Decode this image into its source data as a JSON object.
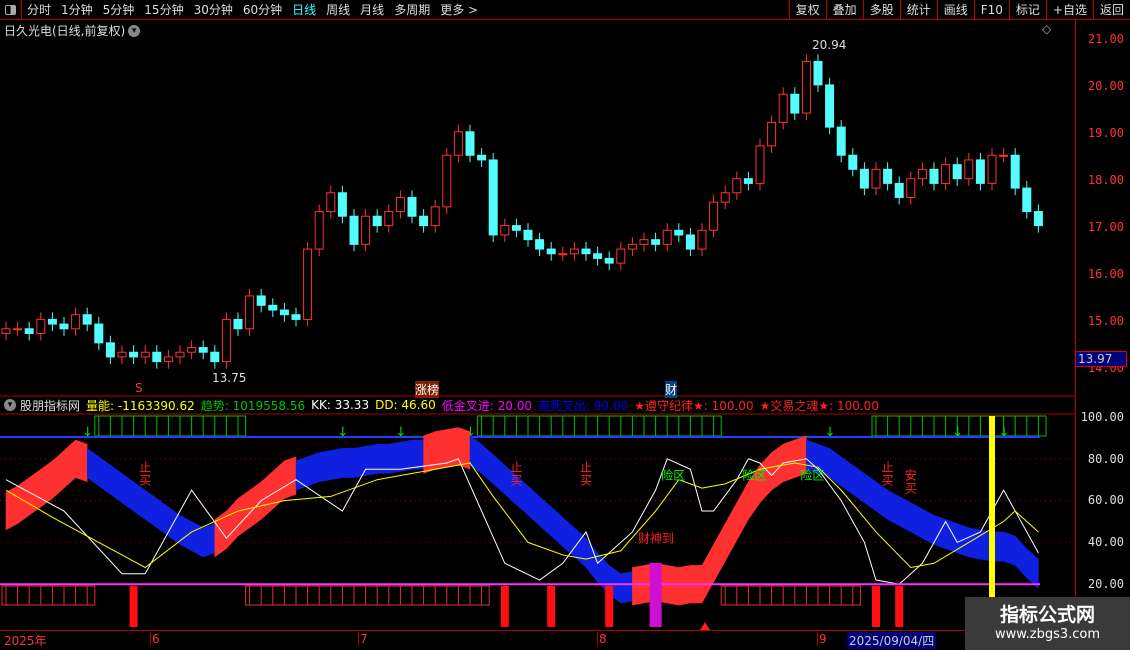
{
  "toolbar": {
    "periods": [
      "分时",
      "1分钟",
      "5分钟",
      "15分钟",
      "30分钟",
      "60分钟",
      "日线",
      "周线",
      "月线",
      "多周期",
      "更多 >"
    ],
    "active_period": "日线",
    "right_buttons": [
      "复权",
      "叠加",
      "多股",
      "统计",
      "画线",
      "F10",
      "标记",
      "+自选",
      "返回"
    ]
  },
  "title": "日久光电(日线,前复权)",
  "price_axis": [
    "21.00",
    "20.00",
    "19.00",
    "18.00",
    "17.00",
    "16.00",
    "15.00",
    "14.00"
  ],
  "last_price": "13.97",
  "high_label": "20.94",
  "low_label": "13.75",
  "markers": {
    "m1": "S",
    "m2": "涨榜",
    "m3": "财"
  },
  "indicator": {
    "name": "股朋指标网",
    "items": [
      {
        "label": "量能: -1163390.62",
        "color": "#ffff00"
      },
      {
        "label": "趋势: 1019558.56",
        "color": "#00c000"
      },
      {
        "label": "KK: 33.33",
        "color": "#ffffff"
      },
      {
        "label": "DD: 46.60",
        "color": "#ffff00"
      },
      {
        "label": "低金叉进: 20.00",
        "color": "#ff00ff"
      },
      {
        "label": "高死叉出: 90.00",
        "color": "#0000ff"
      },
      {
        "label": "★遵守纪律★: 100.00",
        "color": "#ff2020"
      },
      {
        "label": "★交易之魂★: 100.00",
        "color": "#ff2020"
      }
    ],
    "axis": [
      "100.00",
      "80.00",
      "60.00",
      "40.00",
      "20.00"
    ],
    "signals": {
      "stop": "止买",
      "safe": "安买",
      "risk": "险区",
      "wealth": "财神到"
    }
  },
  "dates": {
    "d0": "2025年",
    "d6": "6",
    "d7": "7",
    "d8": "8",
    "d9": "9",
    "current": "2025/09/04/四"
  },
  "watermark": {
    "line1": "指标公式网",
    "line2": "www.zbgs3.com"
  },
  "chart_data": {
    "type": "candlestick",
    "closes": [
      14.8,
      14.8,
      14.7,
      15.0,
      14.9,
      14.8,
      15.1,
      14.9,
      14.5,
      14.2,
      14.3,
      14.2,
      14.3,
      14.1,
      14.2,
      14.3,
      14.4,
      14.3,
      14.1,
      15.0,
      14.8,
      15.5,
      15.3,
      15.2,
      15.1,
      15.0,
      16.5,
      17.3,
      17.7,
      17.2,
      16.6,
      17.2,
      17.0,
      17.3,
      17.6,
      17.2,
      17.0,
      17.4,
      18.5,
      19.0,
      18.5,
      18.4,
      16.8,
      17.0,
      16.9,
      16.7,
      16.5,
      16.4,
      16.4,
      16.5,
      16.4,
      16.3,
      16.2,
      16.5,
      16.6,
      16.7,
      16.6,
      16.9,
      16.8,
      16.5,
      16.9,
      17.5,
      17.7,
      18.0,
      17.9,
      18.7,
      19.2,
      19.8,
      19.4,
      20.5,
      20.0,
      19.1,
      18.5,
      18.2,
      17.8,
      18.2,
      17.9,
      17.6,
      18.0,
      18.2,
      17.9,
      18.3,
      18.0,
      18.4,
      17.9,
      18.5,
      18.5,
      17.8,
      17.3,
      17.0
    ],
    "ylim": [
      13.6,
      21.3
    ],
    "indicator": {
      "ylim": [
        0,
        105
      ],
      "band_center": [
        55,
        58,
        62,
        66,
        70,
        75,
        80,
        78,
        74,
        70,
        66,
        62,
        58,
        54,
        50,
        46,
        43,
        40,
        42,
        46,
        52,
        56,
        60,
        65,
        70,
        72,
        74,
        76,
        77,
        78,
        78,
        79,
        80,
        80,
        81,
        82,
        82,
        84,
        85,
        86,
        84,
        80,
        75,
        70,
        65,
        60,
        55,
        50,
        45,
        40,
        35,
        28,
        22,
        18,
        19,
        20,
        21,
        20,
        19,
        20,
        20,
        30,
        40,
        50,
        60,
        68,
        74,
        78,
        80,
        82,
        80,
        78,
        74,
        70,
        66,
        62,
        58,
        55,
        52,
        49,
        46,
        44,
        42,
        40,
        39,
        38,
        38,
        36,
        30,
        25
      ],
      "band_bull": "1111111000000000001111111000000000001111000000000000001111111111111110000000000000000000000",
      "kk": [
        [
          0,
          70
        ],
        [
          5,
          55
        ],
        [
          10,
          25
        ],
        [
          12,
          25
        ],
        [
          16,
          65
        ],
        [
          19,
          42
        ],
        [
          22,
          60
        ],
        [
          25,
          70
        ],
        [
          29,
          55
        ],
        [
          31,
          75
        ],
        [
          34,
          75
        ],
        [
          38,
          78
        ],
        [
          39,
          80
        ],
        [
          41,
          55
        ],
        [
          43,
          30
        ],
        [
          46,
          22
        ],
        [
          48,
          30
        ],
        [
          50,
          45
        ],
        [
          51,
          30
        ],
        [
          54,
          45
        ],
        [
          56,
          65
        ],
        [
          57,
          80
        ],
        [
          59,
          75
        ],
        [
          60,
          55
        ],
        [
          61,
          55
        ],
        [
          63,
          70
        ],
        [
          64,
          80
        ],
        [
          65,
          78
        ],
        [
          66,
          72
        ],
        [
          67,
          78
        ],
        [
          69,
          80
        ],
        [
          70,
          75
        ],
        [
          72,
          60
        ],
        [
          74,
          40
        ],
        [
          75,
          22
        ],
        [
          77,
          20
        ],
        [
          79,
          30
        ],
        [
          81,
          50
        ],
        [
          82,
          40
        ],
        [
          84,
          45
        ],
        [
          86,
          65
        ],
        [
          87,
          55
        ],
        [
          89,
          35
        ]
      ],
      "dd": [
        [
          0,
          65
        ],
        [
          4,
          52
        ],
        [
          8,
          40
        ],
        [
          12,
          28
        ],
        [
          16,
          45
        ],
        [
          20,
          55
        ],
        [
          24,
          60
        ],
        [
          28,
          62
        ],
        [
          32,
          70
        ],
        [
          36,
          74
        ],
        [
          40,
          78
        ],
        [
          42,
          62
        ],
        [
          45,
          40
        ],
        [
          48,
          34
        ],
        [
          50,
          32
        ],
        [
          53,
          36
        ],
        [
          56,
          55
        ],
        [
          58,
          70
        ],
        [
          60,
          66
        ],
        [
          62,
          68
        ],
        [
          65,
          75
        ],
        [
          68,
          78
        ],
        [
          70,
          76
        ],
        [
          72,
          65
        ],
        [
          75,
          45
        ],
        [
          78,
          28
        ],
        [
          80,
          30
        ],
        [
          83,
          40
        ],
        [
          86,
          50
        ],
        [
          87,
          55
        ],
        [
          89,
          45
        ]
      ],
      "reference_level": 20,
      "top_hollow_ranges": [
        [
          8,
          21
        ],
        [
          41,
          62
        ],
        [
          75,
          90
        ]
      ],
      "green_arrows": [
        7,
        29,
        34,
        40,
        71,
        82,
        86
      ],
      "bottom_hollow_ranges": [
        [
          0,
          8
        ],
        [
          21,
          42
        ],
        [
          62,
          74
        ]
      ],
      "bottom_solid": [
        11,
        43,
        47,
        52,
        75,
        77
      ],
      "magenta_bar": 56,
      "yellow_line": 85,
      "stop_signals": [
        12,
        44,
        50,
        76
      ],
      "safe_signal": 78,
      "risk_signals": [
        57,
        64,
        69
      ],
      "wealth_signal": 56
    }
  }
}
